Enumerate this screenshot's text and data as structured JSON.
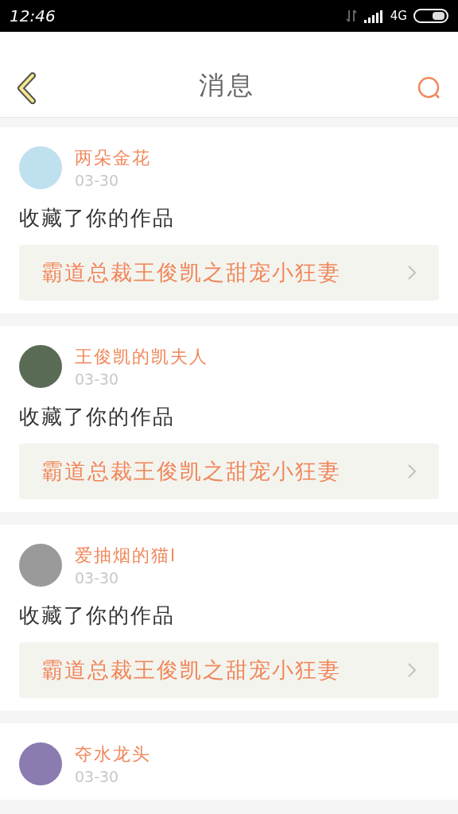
{
  "status_bar": {
    "time": "12:46",
    "network": "4G"
  },
  "header": {
    "title": "消息"
  },
  "messages": [
    {
      "user": "两朵金花",
      "date": "03-30",
      "action": "收藏了你的作品",
      "work": "霸道总裁王俊凯之甜宠小狂妻"
    },
    {
      "user": "王俊凯的凯夫人",
      "date": "03-30",
      "action": "收藏了你的作品",
      "work": "霸道总裁王俊凯之甜宠小狂妻"
    },
    {
      "user": "爱抽烟的猫l",
      "date": "03-30",
      "action": "收藏了你的作品",
      "work": "霸道总裁王俊凯之甜宠小狂妻"
    },
    {
      "user": "夺水龙头",
      "date": "03-30"
    }
  ]
}
